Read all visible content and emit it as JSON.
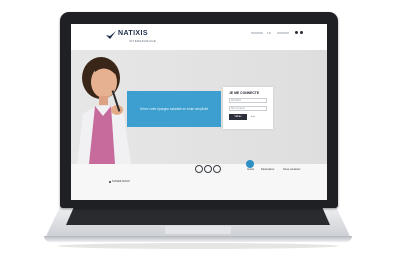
{
  "brand": {
    "name": "NATIXIS",
    "tagline": "INTEREPARGNE",
    "color": "#1b2a4a"
  },
  "header": {
    "lang_label": "FR"
  },
  "hero": {
    "promo_text": "Gérez votre épargne salariale en toute simplicité",
    "promo_color": "#3c9fcf"
  },
  "login": {
    "title": "JE ME CONNECTE",
    "id_placeholder": "Identifiant",
    "password_placeholder": "Mot de passe",
    "submit_label": "Valider",
    "help_link": "Aide"
  },
  "footer": {
    "links": [
      "Accès",
      "Partenaires",
      "Nous contacter"
    ],
    "social_icons": [
      "facebook-icon",
      "twitter-icon",
      "linkedin-icon"
    ],
    "left_label": "SUIVEZ-NOUS"
  },
  "chat": {
    "icon": "chat-icon",
    "color": "#2d8fc4"
  }
}
